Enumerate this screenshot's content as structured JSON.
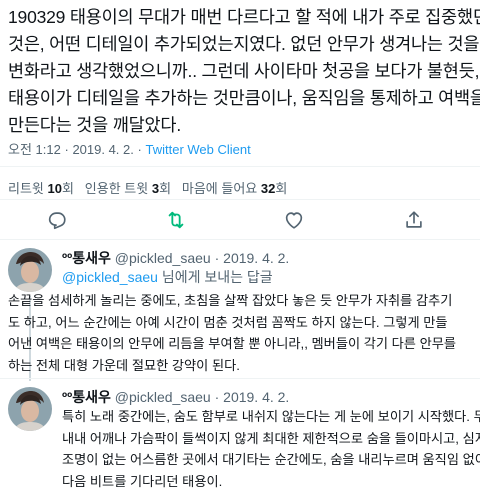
{
  "main_tweet": {
    "lines": [
      "190329 태용이의 무대가 매번 다르다고 할 적에 내가 주로 집중했던",
      "것은, 어떤 디테일이 추가되었는지였다. 없던 안무가 생겨나는 것을",
      "변화라고 생각했었으니까.. 그런데 사이타마 첫공을 보다가 불현듯,",
      "태용이가 디테일을 추가하는 것만큼이나, 움직임을 통제하고 여백을",
      "만든다는 것을 깨달았다."
    ],
    "time": "오전 1:12",
    "date": "2019. 4. 2.",
    "client": "Twitter Web Client",
    "sep": "·"
  },
  "stats": {
    "retweets_label": "리트윗",
    "retweets": "10",
    "retweets_unit": "회",
    "quotes_label": "인용한 트윗",
    "quotes": "3",
    "quotes_unit": "회",
    "likes_label": "마음에 들어요",
    "likes": "32",
    "likes_unit": "회"
  },
  "actions": {
    "reply_icon": "reply-icon",
    "retweet_icon": "retweet-icon",
    "like_icon": "heart-icon",
    "share_icon": "share-icon",
    "retweet_color": "#00ba7c"
  },
  "replies": [
    {
      "name": "ºº통새우",
      "handle": "@pickled_saeu",
      "date": "2019. 4. 2.",
      "sep": "·",
      "replying_mention": "@pickled_saeu",
      "replying_text": " 님에게 보내는 답글",
      "lines": [
        "손끝을 섬세하게 놀리는 중에도, 초침을 살짝 잡았다 놓은 듯 안무가 자취를 감추기",
        "도 하고, 어느 순간에는 아예 시간이 멈춘 것처럼 꼼짝도 하지 않는다. 그렇게 만들",
        "어낸 여백은 태용이의 안무에 리듬을 부여할 뿐 아니라,, 멤버들이 각기 다른 안무를",
        "하는 전체 대형 가운데 절묘한 강약이 된다."
      ]
    },
    {
      "name": "ºº통새우",
      "handle": "@pickled_saeu",
      "date": "2019. 4. 2.",
      "sep": "·",
      "lines": [
        "특히 노래 중간에는, 숨도 함부로 내쉬지 않는다는 게 눈에 보이기 시작했다. 무대",
        "내내 어깨나 가슴팍이 들썩이지 않게 최대한 제한적으로 숨을 들이마시고, 심지어",
        "조명이 없는 어스름한 곳에서 대기타는 순간에도, 숨을 내리누르며 움직임 없이 그",
        "다음 비트를 기다리던 태용이."
      ]
    }
  ]
}
